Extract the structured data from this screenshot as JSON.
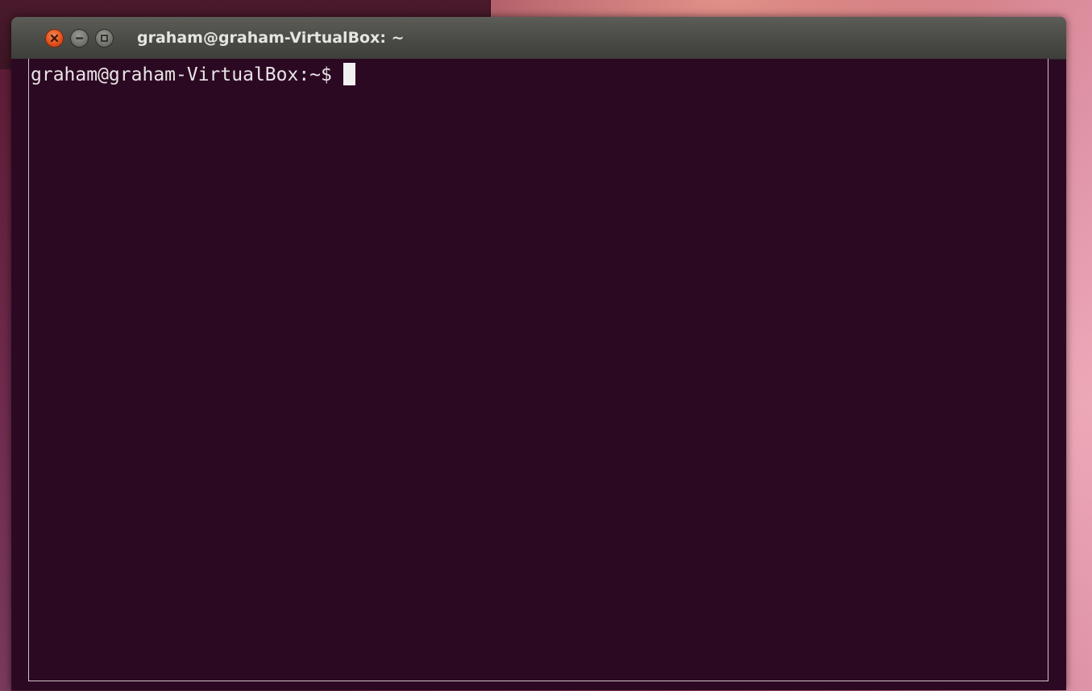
{
  "desktop": {
    "background_panel_caption": "ˇ",
    "colors": {
      "terminal_background": "#2c0922",
      "close_button": "#e2521d",
      "titlebar": "#4a4a46"
    }
  },
  "window": {
    "title": "graham@graham-VirtualBox: ~",
    "buttons": [
      {
        "name": "close",
        "icon": "close-icon"
      },
      {
        "name": "minimize",
        "icon": "minimize-icon"
      },
      {
        "name": "maximize",
        "icon": "maximize-icon"
      }
    ]
  },
  "terminal": {
    "prompt": "graham@graham-VirtualBox:~$",
    "input": ""
  }
}
